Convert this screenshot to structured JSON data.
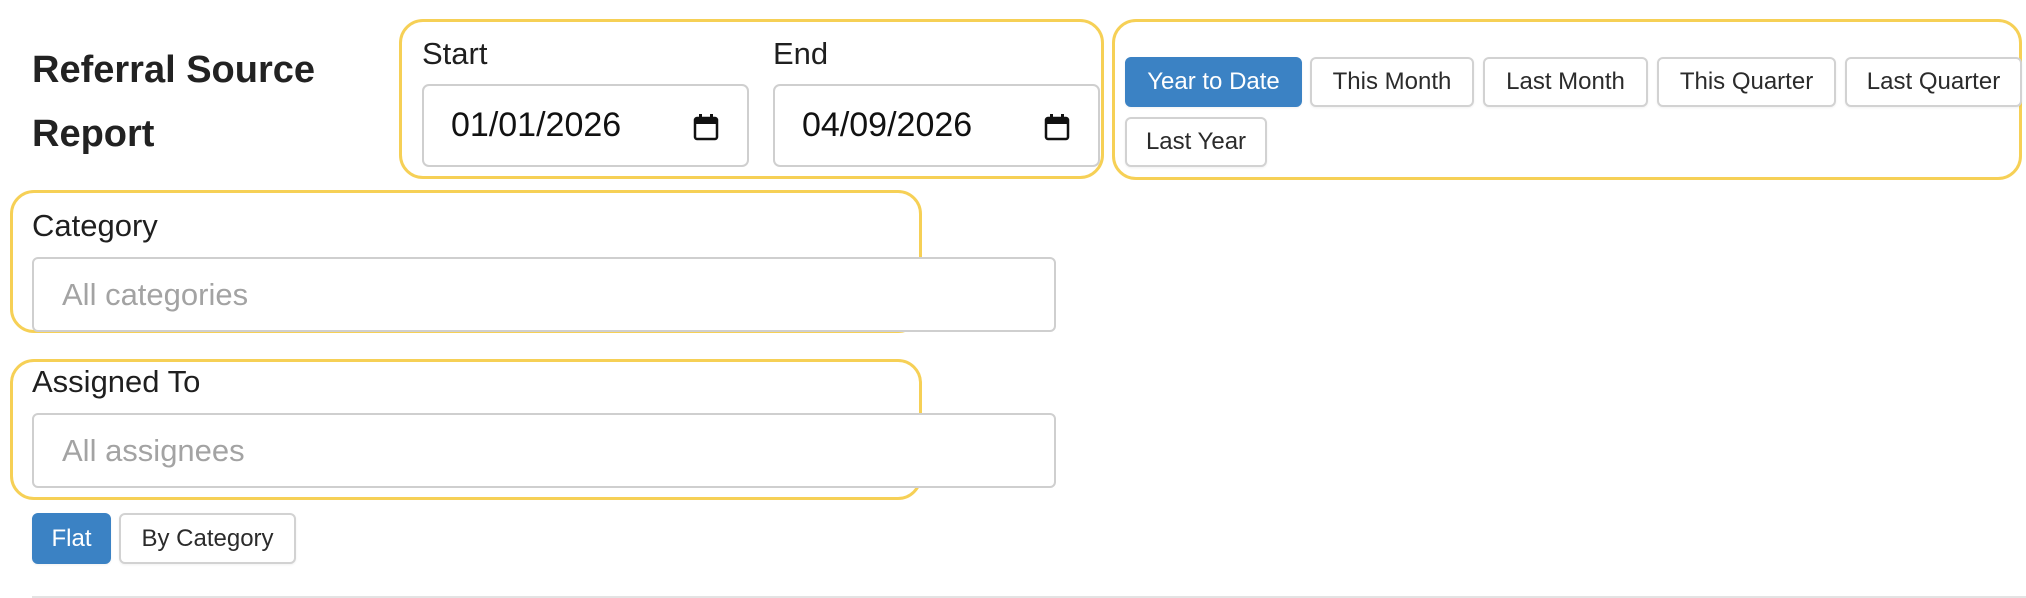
{
  "report": {
    "title": "Referral Source Report"
  },
  "date_range": {
    "start_label": "Start",
    "start_value": "01/01/2026",
    "end_label": "End",
    "end_value": "04/09/2026"
  },
  "periods": [
    {
      "label": "Year to Date",
      "active": true
    },
    {
      "label": "This Month",
      "active": false
    },
    {
      "label": "Last Month",
      "active": false
    },
    {
      "label": "This Quarter",
      "active": false
    },
    {
      "label": "Last Quarter",
      "active": false
    },
    {
      "label": "Last Year",
      "active": false
    }
  ],
  "filters": {
    "category_label": "Category",
    "category_placeholder": "All categories",
    "assigned_label": "Assigned To",
    "assigned_placeholder": "All assignees"
  },
  "view_mode": {
    "flat_label": "Flat",
    "by_category_label": "By Category",
    "active": "Flat"
  },
  "colors": {
    "primary": "#3b82c4",
    "highlight": "#f6d056"
  },
  "icons": {
    "date_picker": "calendar-icon"
  }
}
